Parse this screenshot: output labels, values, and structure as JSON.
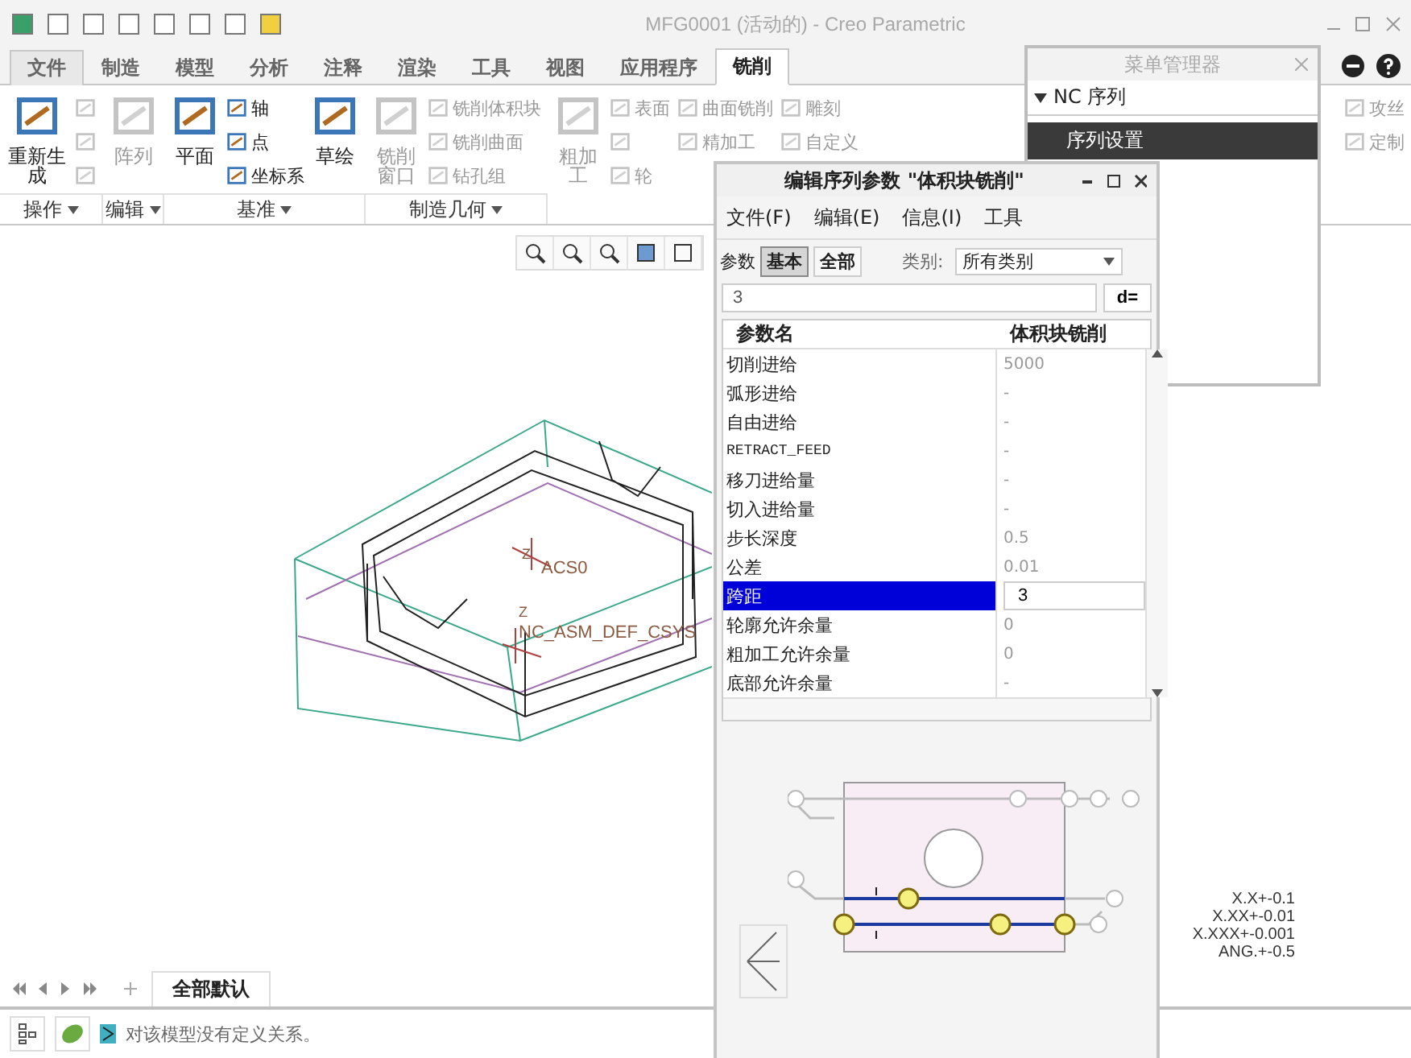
{
  "window": {
    "title": "MFG0001 (活动的) - Creo Parametric"
  },
  "tabs": [
    {
      "label": "文件",
      "kind": "menu",
      "selected": false
    },
    {
      "label": "制造",
      "kind": "tab",
      "selected": false
    },
    {
      "label": "模型",
      "kind": "tab",
      "selected": false
    },
    {
      "label": "分析",
      "kind": "tab",
      "selected": false
    },
    {
      "label": "注释",
      "kind": "tab",
      "selected": false
    },
    {
      "label": "渲染",
      "kind": "tab",
      "selected": false
    },
    {
      "label": "工具",
      "kind": "tab",
      "selected": false
    },
    {
      "label": "视图",
      "kind": "tab",
      "selected": false
    },
    {
      "label": "应用程序",
      "kind": "tab",
      "selected": false
    },
    {
      "label": "铣削",
      "kind": "tab",
      "selected": true
    }
  ],
  "ribbon": {
    "groups": [
      {
        "label": "操作",
        "columns": [
          {
            "kind": "large",
            "label": "重新生成",
            "disabled": false
          },
          {
            "kind": "stack",
            "items": [
              {
                "disabled": true
              },
              {
                "disabled": true
              },
              {
                "disabled": true
              }
            ]
          }
        ]
      },
      {
        "label": "编辑",
        "columns": [
          {
            "kind": "large",
            "label": "阵列",
            "disabled": true
          }
        ]
      },
      {
        "label": "基准",
        "columns": [
          {
            "kind": "large",
            "label": "平面",
            "disabled": false
          },
          {
            "kind": "stack",
            "items": [
              {
                "label": "轴",
                "disabled": false
              },
              {
                "label": "点",
                "disabled": false
              },
              {
                "label": "坐标系",
                "disabled": false
              }
            ]
          },
          {
            "kind": "large",
            "label": "草绘",
            "disabled": false
          }
        ]
      },
      {
        "label": "制造几何",
        "columns": [
          {
            "kind": "large",
            "label": "铣削窗口",
            "disabled": true
          },
          {
            "kind": "stack",
            "items": [
              {
                "label": "铣削体积块",
                "disabled": true
              },
              {
                "label": "铣削曲面",
                "disabled": true
              },
              {
                "label": "钻孔组",
                "disabled": true
              }
            ]
          }
        ]
      },
      {
        "columns": [
          {
            "kind": "large",
            "label": "粗加工",
            "disabled": true
          },
          {
            "kind": "stack",
            "items": [
              {
                "label": "表面",
                "disabled": true
              },
              {
                "disabled": true
              },
              {
                "label": "轮",
                "disabled": true
              }
            ]
          },
          {
            "kind": "stack",
            "items": [
              {
                "label": "曲面铣削",
                "disabled": true
              },
              {
                "label": "精加工",
                "disabled": true
              }
            ]
          },
          {
            "kind": "stack",
            "items": [
              {
                "label": "雕刻",
                "disabled": true
              },
              {
                "label": "自定义",
                "disabled": true
              }
            ]
          }
        ]
      },
      {
        "columns": [
          {
            "kind": "stack",
            "items": [
              {
                "label": "攻丝",
                "disabled": true
              },
              {
                "label": "定制",
                "disabled": true
              }
            ]
          }
        ]
      }
    ]
  },
  "menu_manager": {
    "title": "菜单管理器",
    "sections": [
      {
        "label": "NC 序列",
        "expanded": true,
        "items": [
          {
            "label": "序列设置",
            "selected": true
          }
        ]
      }
    ]
  },
  "model": {
    "labels": [
      "ACS0",
      "NC_ASM_DEF_CSYS"
    ],
    "axis_labels": [
      "Z",
      "Z"
    ]
  },
  "tolerances": [
    "X.X+-0.1",
    "X.XX+-0.01",
    "X.XXX+-0.001",
    "ANG.+-0.5"
  ],
  "sheet_tabs": [
    {
      "label": "全部默认",
      "selected": true
    }
  ],
  "status": {
    "message": "对该模型没有定义关系。"
  },
  "dialog": {
    "title": "编辑序列参数 \"体积块铣削\"",
    "menu": [
      "文件(F)",
      "编辑(E)",
      "信息(I)",
      "工具"
    ],
    "mode_label": "参数",
    "modes": [
      {
        "label": "基本",
        "selected": true
      },
      {
        "label": "全部",
        "selected": false
      }
    ],
    "category_label": "类别:",
    "category": "所有类别",
    "value_field": "3",
    "formula_button": "d=",
    "columns": [
      "参数名",
      "体积块铣削"
    ],
    "rows": [
      {
        "name": "切削进给",
        "value": "5000",
        "kind": "param",
        "selected": false
      },
      {
        "name": "弧形进给",
        "value": "-",
        "kind": "param",
        "selected": false
      },
      {
        "name": "自由进给",
        "value": "-",
        "kind": "param",
        "selected": false
      },
      {
        "name": "RETRACT_FEED",
        "value": "-",
        "kind": "code",
        "selected": false
      },
      {
        "name": "移刀进给量",
        "value": "-",
        "kind": "param",
        "selected": false
      },
      {
        "name": "切入进给量",
        "value": "-",
        "kind": "param",
        "selected": false
      },
      {
        "name": "步长深度",
        "value": "0.5",
        "kind": "param",
        "selected": false
      },
      {
        "name": "公差",
        "value": "0.01",
        "kind": "param",
        "selected": false
      },
      {
        "name": "跨距",
        "value": "3",
        "kind": "param",
        "selected": true
      },
      {
        "name": "轮廓允许余量",
        "value": "0",
        "kind": "param",
        "selected": false
      },
      {
        "name": "粗加工允许余量",
        "value": "0",
        "kind": "param",
        "selected": false
      },
      {
        "name": "底部允许余量",
        "value": "-",
        "kind": "param",
        "selected": false
      }
    ]
  }
}
